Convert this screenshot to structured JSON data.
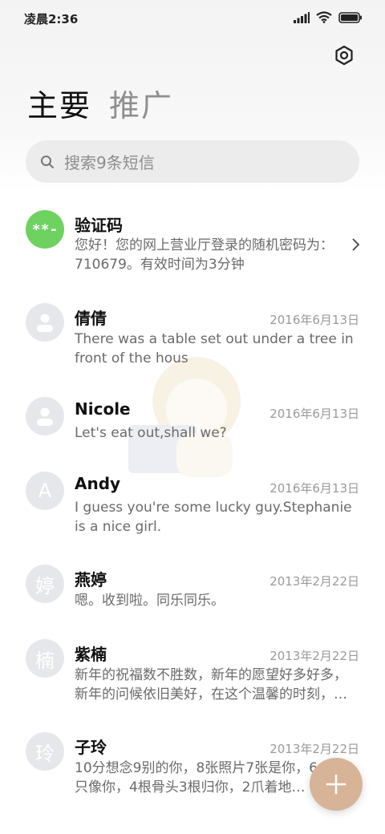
{
  "status_bar": {
    "time": "凌晨2:36",
    "icons": [
      "signal-icon",
      "wifi-icon",
      "battery-icon"
    ]
  },
  "header": {
    "settings_icon": "gear-icon",
    "tabs": [
      {
        "label": "主要",
        "active": true
      },
      {
        "label": "推广",
        "active": false
      }
    ]
  },
  "search": {
    "placeholder": "搜索9条短信",
    "icon": "search-icon"
  },
  "messages": [
    {
      "avatar": "**-",
      "avatar_type": "code",
      "name": "验证码",
      "date": "",
      "preview": "您好！您的网上营业厅登录的随机密码为：710679。有效时间为3分钟",
      "has_chevron": true
    },
    {
      "avatar": "",
      "avatar_type": "person",
      "name": "倩倩",
      "date": "2016年6月13日",
      "preview": "There was a table set out under a tree in front of the hous"
    },
    {
      "avatar": "",
      "avatar_type": "person",
      "name": "Nicole",
      "date": "2016年6月13日",
      "preview": "Let's eat out,shall we?"
    },
    {
      "avatar": "A",
      "avatar_type": "letter",
      "name": "Andy",
      "date": "2016年6月13日",
      "preview": "I guess you're some lucky guy.Stephanie is a nice girl."
    },
    {
      "avatar": "婷",
      "avatar_type": "letter",
      "name": "燕婷",
      "date": "2013年2月22日",
      "preview": "嗯。收到啦。同乐同乐。"
    },
    {
      "avatar": "楠",
      "avatar_type": "letter",
      "name": "紫楠",
      "date": "2013年2月22日",
      "preview": "新年的祝福数不胜数，新年的愿望好多好多，新年的问候依旧美好，在这个温馨的时刻，…"
    },
    {
      "avatar": "玲",
      "avatar_type": "letter",
      "name": "子玲",
      "date": "2013年2月22日",
      "preview": "10分想念9别的你，8张照片7张是你，6…狗5只像你，4根骨头3根归你，2爪着地…"
    }
  ],
  "fab": {
    "icon": "plus-icon",
    "color": "#d7b497"
  },
  "colors": {
    "accent_green": "#6dd25f",
    "avatar_gray": "#e6e7ea",
    "fab": "#d7b497"
  }
}
